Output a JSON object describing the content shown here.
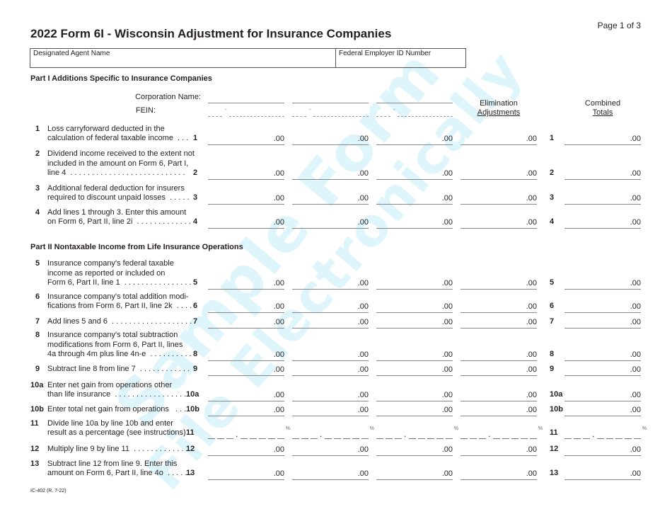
{
  "page": {
    "page_number": "Page 1 of 3",
    "title": "2022 Form 6I - Wisconsin Adjustment for Insurance Companies",
    "footer": "IC-402 (R. 7-22)"
  },
  "header_box": {
    "agent_label": "Designated Agent Name",
    "fein_label": "Federal Employer ID Number"
  },
  "watermark": {
    "line1": "Sample Form",
    "line2": "File Electronically",
    "color": "#dff5fc"
  },
  "part1": {
    "heading": "Part I  Additions Specific to Insurance Companies",
    "corp_name_label": "Corporation Name:",
    "fein_label": "FEIN:",
    "elimination_header": [
      "Elimination",
      "Adjustments"
    ],
    "combined_header": [
      "Combined",
      "Totals"
    ],
    "rows": [
      {
        "num": "1",
        "text": "Loss carryforward deducted in the\ncalculation of federal taxable income  . . .",
        "ref": "1",
        "values": [
          ".00",
          ".00",
          ".00",
          ".00"
        ],
        "total": ".00"
      },
      {
        "num": "2",
        "text": "Dividend income received to the extent not\nincluded in the amount on Form 6, Part I,\nline 4  . . . . . . . . . . . . . . . . . . . . . . . . . . .",
        "ref": "2",
        "values": [
          ".00",
          ".00",
          ".00",
          ".00"
        ],
        "total": ".00"
      },
      {
        "num": "3",
        "text": "Additional federal deduction for insurers\nrequired to discount unpaid losses  . . . . .",
        "ref": "3",
        "values": [
          ".00",
          ".00",
          ".00",
          ".00"
        ],
        "total": ".00"
      },
      {
        "num": "4",
        "text": "Add lines 1 through 3. Enter this amount\non Form 6, Part II, line 2i  . . . . . . . . . . . . .",
        "ref": "4",
        "values": [
          ".00",
          ".00",
          ".00",
          ".00"
        ],
        "total": ".00"
      }
    ]
  },
  "part2": {
    "heading": "Part II  Nontaxable Income from Life Insurance Operations",
    "rows": [
      {
        "num": "5",
        "text": "Insurance company's federal taxable\nincome as reported or included on\nForm 6, Part II, line 1  . . . . . . . . . . . . . . . .",
        "ref": "5",
        "values": [
          ".00",
          ".00",
          ".00",
          ".00"
        ],
        "total": ".00"
      },
      {
        "num": "6",
        "text": "Insurance company's total addition modi-\nfications from Form 6, Part II, line 2k  . . . .",
        "ref": "6",
        "values": [
          ".00",
          ".00",
          ".00",
          ".00"
        ],
        "total": ".00"
      },
      {
        "num": "7",
        "text": "Add lines 5 and 6  . . . . . . . . . . . . . . . . . . .",
        "ref": "7",
        "values": [
          ".00",
          ".00",
          ".00",
          ".00"
        ],
        "total": ".00"
      },
      {
        "num": "8",
        "text": "Insurance company's total subtraction\nmodifications from Form 6, Part II, lines\n4a through 4m plus line 4n-e  . . . . . . . . . .",
        "ref": "8",
        "values": [
          ".00",
          ".00",
          ".00",
          ".00"
        ],
        "total": ".00"
      },
      {
        "num": "9",
        "text": "Subtract line 8 from line 7  . . . . . . . . . . . .",
        "ref": "9",
        "values": [
          ".00",
          ".00",
          ".00",
          ".00"
        ],
        "total": ".00"
      },
      {
        "num": "10a",
        "text": "Enter net gain from operations other\nthan life insurance  . . . . . . . . . . . . . . . . . .",
        "ref": "10a",
        "values": [
          ".00",
          ".00",
          ".00",
          ".00"
        ],
        "total": ".00"
      },
      {
        "num": "10b",
        "text": "Enter total net gain from operations   . . . .",
        "ref": "10b",
        "values": [
          ".00",
          ".00",
          ".00",
          ".00"
        ],
        "total": ".00"
      },
      {
        "num": "11",
        "text": "Divide line 10a by line 10b and enter\nresult as a percentage (see instructions)",
        "ref": "11",
        "percent": true,
        "percent_symbol": "%",
        "values": [
          "",
          "",
          "",
          ""
        ],
        "total": ""
      },
      {
        "num": "12",
        "text": "Multiply line 9 by line 11  . . . . . . . . . . . . . .",
        "ref": "12",
        "values": [
          ".00",
          ".00",
          ".00",
          ".00"
        ],
        "total": ".00"
      },
      {
        "num": "13",
        "text": "Subtract line 12 from line 9. Enter this\namount on Form 6, Part II, line 4o  . . . . . .",
        "ref": "13",
        "values": [
          ".00",
          ".00",
          ".00",
          ".00"
        ],
        "total": ".00"
      }
    ]
  }
}
